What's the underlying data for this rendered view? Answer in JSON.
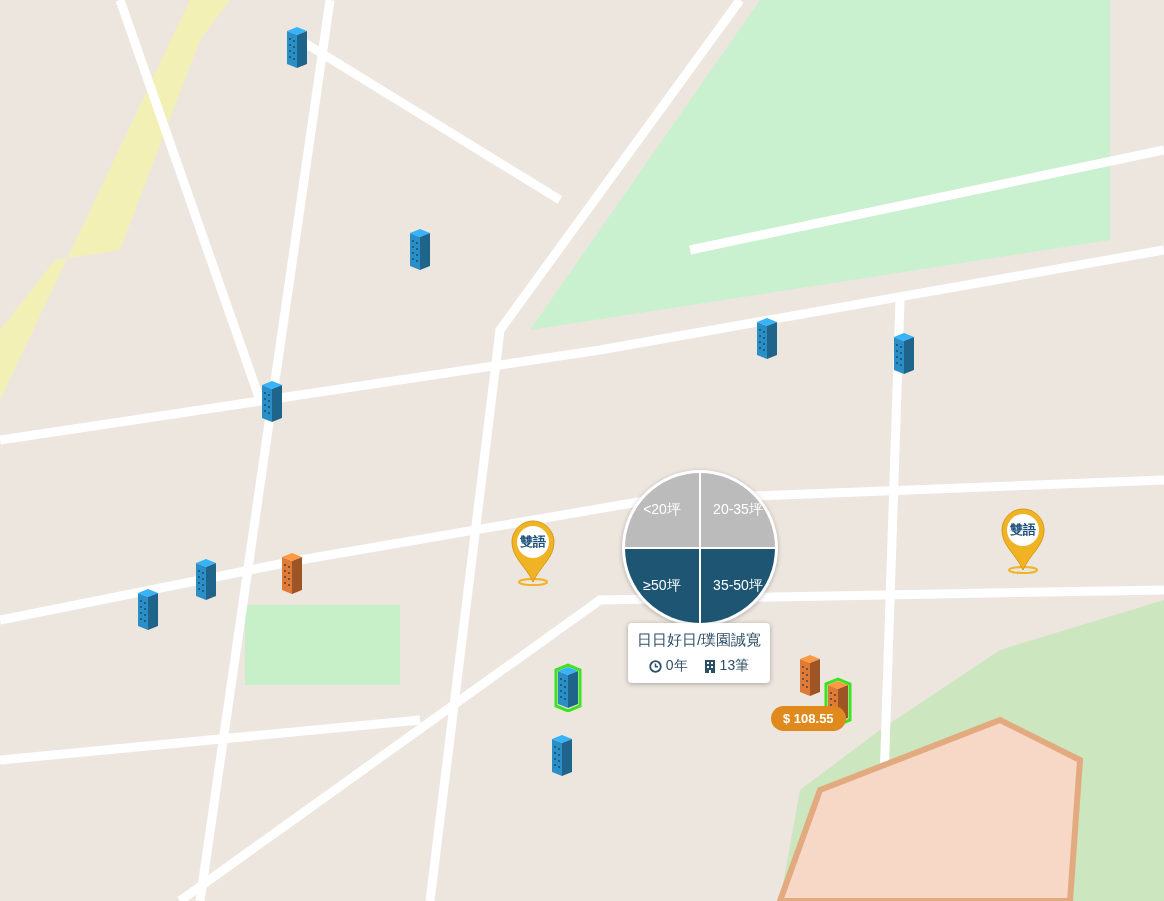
{
  "map": {
    "buildings": [
      {
        "color": "#2b8fc7",
        "selected": false
      },
      {
        "color": "#2b8fc7",
        "selected": false
      },
      {
        "color": "#2b8fc7",
        "selected": false
      },
      {
        "color": "#2b8fc7",
        "selected": false
      },
      {
        "color": "#2b8fc7",
        "selected": false
      },
      {
        "color": "#2b8fc7",
        "selected": false
      },
      {
        "color": "#2b8fc7",
        "selected": false
      },
      {
        "color": "#2b8fc7",
        "selected": true
      },
      {
        "color": "#2b8fc7",
        "selected": false
      },
      {
        "color": "#e07a35",
        "selected": false
      },
      {
        "color": "#e07a35",
        "selected": false
      },
      {
        "color": "#e07a35",
        "selected": true
      }
    ],
    "school_markers": [
      {
        "label": "雙語"
      },
      {
        "label": "雙語"
      }
    ],
    "size_filter": [
      {
        "label": "<20坪",
        "selected": false
      },
      {
        "label": "20-35坪",
        "selected": false
      },
      {
        "label": "≥50坪",
        "selected": true
      },
      {
        "label": "35-50坪",
        "selected": true
      }
    ],
    "popup": {
      "title": "日日好日/璞園誠寬",
      "age": "0年",
      "count": "13筆"
    },
    "price_tag": "$ 108.55"
  }
}
